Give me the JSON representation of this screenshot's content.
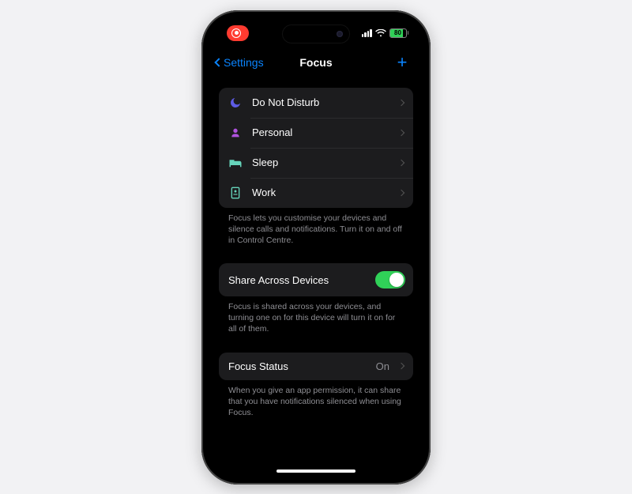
{
  "status": {
    "battery_pct": "80",
    "recording": true
  },
  "nav": {
    "back_label": "Settings",
    "title": "Focus"
  },
  "focus_modes": {
    "footer": "Focus lets you customise your devices and silence calls and notifications. Turn it on and off in Control Centre.",
    "items": [
      {
        "label": "Do Not Disturb",
        "icon": "moon",
        "color": "#5e5ce6"
      },
      {
        "label": "Personal",
        "icon": "person",
        "color": "#af52de"
      },
      {
        "label": "Sleep",
        "icon": "bed",
        "color": "#5ac8a8"
      },
      {
        "label": "Work",
        "icon": "badge",
        "color": "#5ac8a8"
      }
    ]
  },
  "share": {
    "label": "Share Across Devices",
    "on": true,
    "footer": "Focus is shared across your devices, and turning one on for this device will turn it on for all of them."
  },
  "focus_status": {
    "label": "Focus Status",
    "value": "On",
    "footer": "When you give an app permission, it can share that you have notifications silenced when using Focus."
  }
}
